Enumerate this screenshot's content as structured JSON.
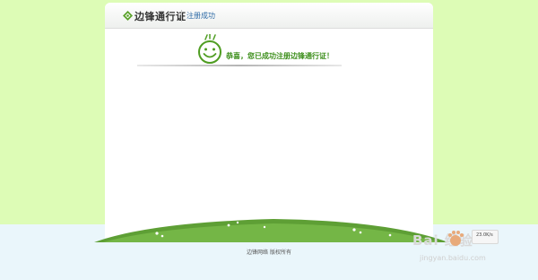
{
  "header": {
    "brand": "边锋通行证",
    "step": "注册成功"
  },
  "message": {
    "text": "恭喜，您已成功注册边锋通行证！"
  },
  "footer": {
    "copyright": "边锋网络 版权所有"
  },
  "watermark": {
    "logo_text": "Bai 经验",
    "url": "jingyan.baidu.com"
  },
  "speed_widget": {
    "value": "23.0K/s"
  },
  "colors": {
    "page_background": "#ddfcb6",
    "card_background": "#ffffff",
    "brand_green": "#3d8f1c",
    "link_blue": "#2d6aa6"
  },
  "icons": [
    "diamond-logo-icon",
    "smiley-face-icon",
    "baidu-paw-icon"
  ]
}
